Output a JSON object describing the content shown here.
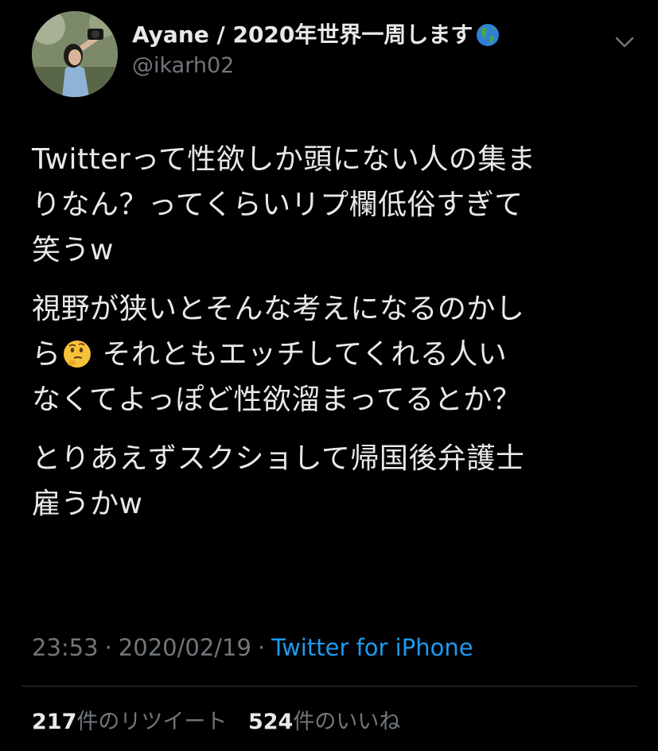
{
  "tweet": {
    "author": {
      "display_name": "Ayane / 2020年世界一周します",
      "display_name_emoji": "globe-americas",
      "handle": "@ikarh02"
    },
    "paragraphs": [
      "Twitterって性欲しか頭にない人の集まりなん？ってくらいリプ欄低俗すぎて笑うw",
      "視野が狭いとそんな考えになるのかしら",
      "それともエッチしてくれる人いなくてよっぽど性欲溜まってるとか？",
      "とりあえずスクショして帰国後弁護士雇うかw"
    ],
    "inline_emoji": "thinking-face",
    "time": "23:53",
    "separator": "·",
    "date": "2020/02/19",
    "client": "Twitter for iPhone",
    "retweets": {
      "count": "217",
      "label": "件のリツイート"
    },
    "likes": {
      "count": "524",
      "label": "件のいいね"
    }
  },
  "colors": {
    "background": "#000000",
    "text_primary": "#e7e9ea",
    "text_secondary": "#71767b",
    "link": "#1d9bf0",
    "divider": "#2f3336"
  }
}
